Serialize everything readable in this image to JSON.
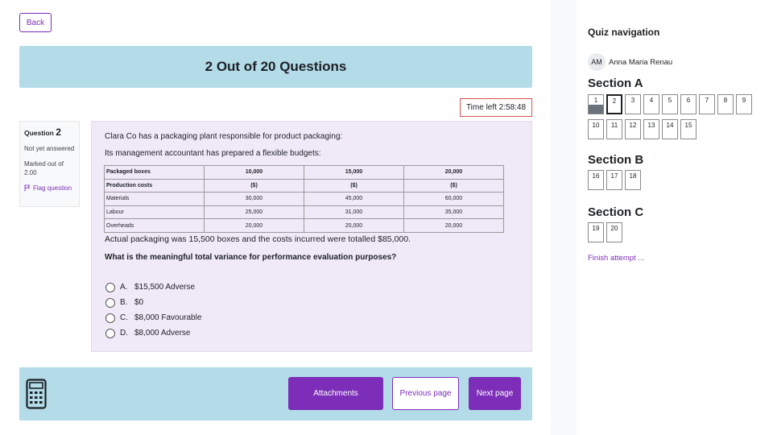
{
  "back_label": "Back",
  "banner_title": "2 Out of 20 Questions",
  "timer": "Time left 2:58:48",
  "question_info": {
    "label": "Question",
    "number": "2",
    "state": "Not yet answered",
    "grade": "Marked out of 2.00",
    "flag": "Flag question"
  },
  "question": {
    "line1": "Clara Co has a packaging plant responsible for product packaging:",
    "line2": "Its management accountant has prepared a flexible budgets:",
    "table": {
      "rows": [
        [
          "Packaged boxes",
          "10,000",
          "15,000",
          "20,000"
        ],
        [
          "Production costs",
          "($)",
          "($)",
          "($)"
        ],
        [
          "Materials",
          "30,000",
          "45,000",
          "60,000"
        ],
        [
          "Labour",
          "25,000",
          "31,000",
          "35,000"
        ],
        [
          "Overheads",
          "20,000",
          "20,000",
          "20,000"
        ]
      ]
    },
    "line3": "Actual packaging was 15,500 boxes and the costs incurred were totalled $85,000.",
    "prompt": "What is the meaningful total variance for performance evaluation purposes?",
    "options": [
      {
        "letter": "A.",
        "text": "$15,500 Adverse"
      },
      {
        "letter": "B.",
        "text": "$0"
      },
      {
        "letter": "C.",
        "text": "$8,000 Favourable"
      },
      {
        "letter": "D.",
        "text": "$8,000 Adverse"
      }
    ]
  },
  "footer": {
    "calculator_icon": "calculator-icon",
    "attachments": "Attachments",
    "previous": "Previous page",
    "next": "Next page"
  },
  "nav": {
    "title": "Quiz navigation",
    "avatar_initials": "AM",
    "user_name": "Anna Maria Renau",
    "sections": [
      {
        "title": "Section A",
        "questions": [
          "1",
          "2",
          "3",
          "4",
          "5",
          "6",
          "7",
          "8",
          "9",
          "10",
          "11",
          "12",
          "13",
          "14",
          "15"
        ]
      },
      {
        "title": "Section B",
        "questions": [
          "16",
          "17",
          "18"
        ]
      },
      {
        "title": "Section C",
        "questions": [
          "19",
          "20"
        ]
      }
    ],
    "answered": [
      "1"
    ],
    "current": "2",
    "finish": "Finish attempt ..."
  },
  "colors": {
    "accent": "#7c2eb8",
    "banner": "#b3dbe8",
    "question_bg": "#f0e9f8",
    "timer_border": "#d9534f"
  }
}
